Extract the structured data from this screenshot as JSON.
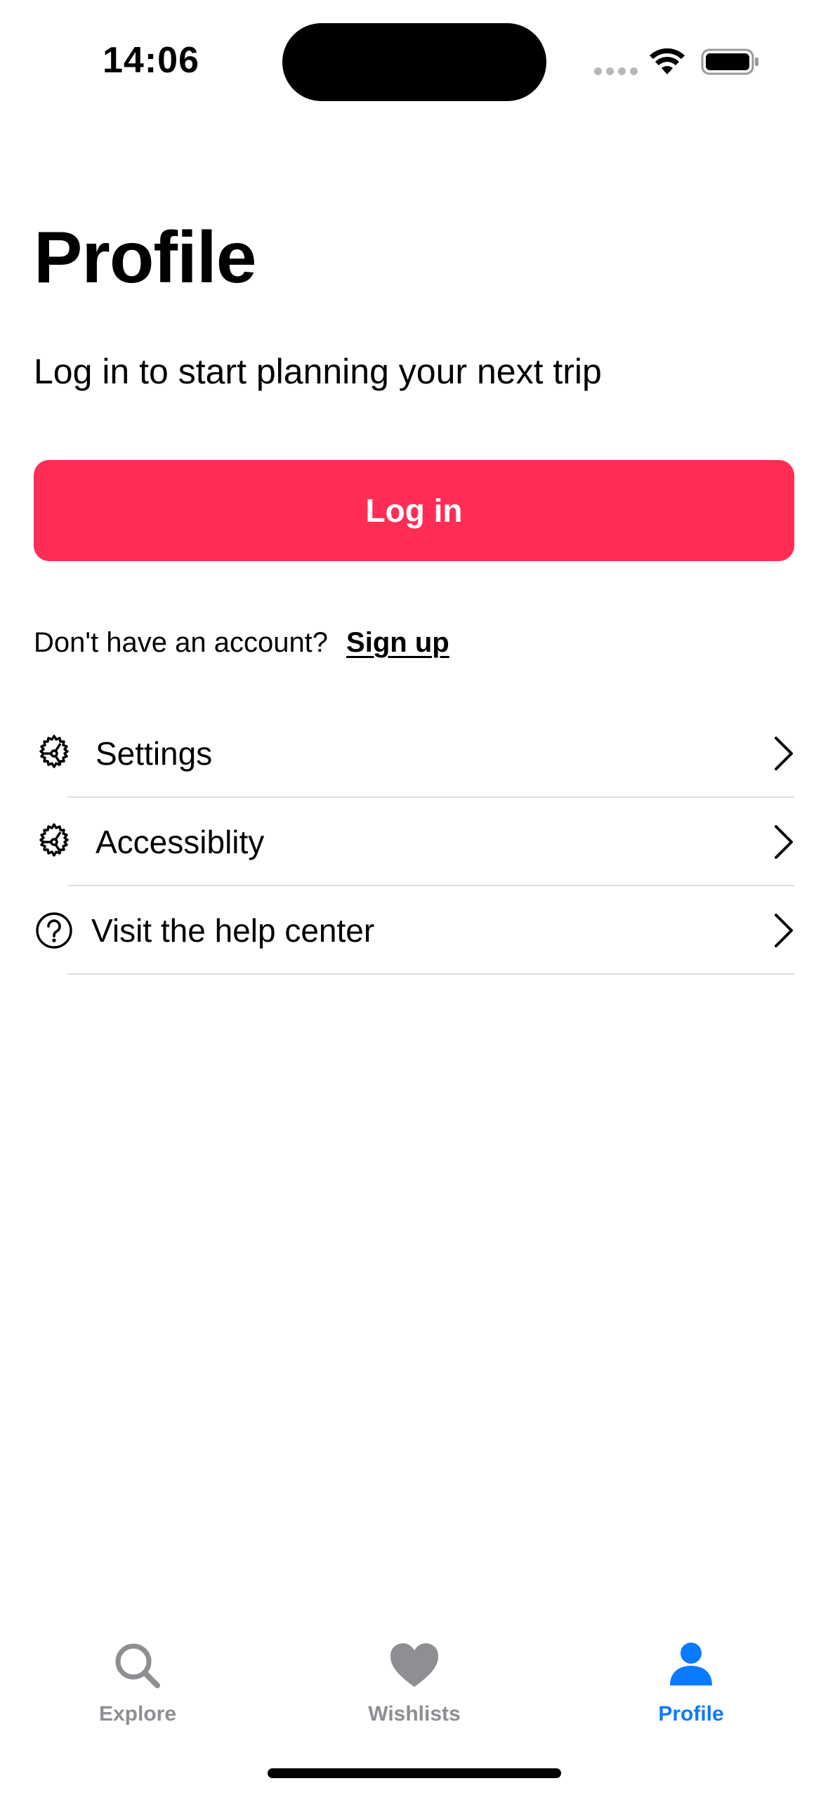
{
  "status_bar": {
    "time": "14:06"
  },
  "header": {
    "title": "Profile",
    "subtitle": "Log in to start planning your next trip"
  },
  "login": {
    "button_label": "Log in",
    "button_color": "#ff2d55"
  },
  "signup": {
    "prompt": "Don't have an account?",
    "link_label": "Sign up"
  },
  "menu": {
    "items": [
      {
        "label": "Settings",
        "icon": "gear-icon"
      },
      {
        "label": "Accessiblity",
        "icon": "gear-icon"
      },
      {
        "label": "Visit the help center",
        "icon": "question-circle-icon"
      }
    ]
  },
  "tab_bar": {
    "active_color": "#0a7aff",
    "inactive_color": "#8e8e93",
    "tabs": [
      {
        "label": "Explore",
        "icon": "search-icon",
        "active": false
      },
      {
        "label": "Wishlists",
        "icon": "heart-icon",
        "active": false
      },
      {
        "label": "Profile",
        "icon": "person-icon",
        "active": true
      }
    ]
  }
}
